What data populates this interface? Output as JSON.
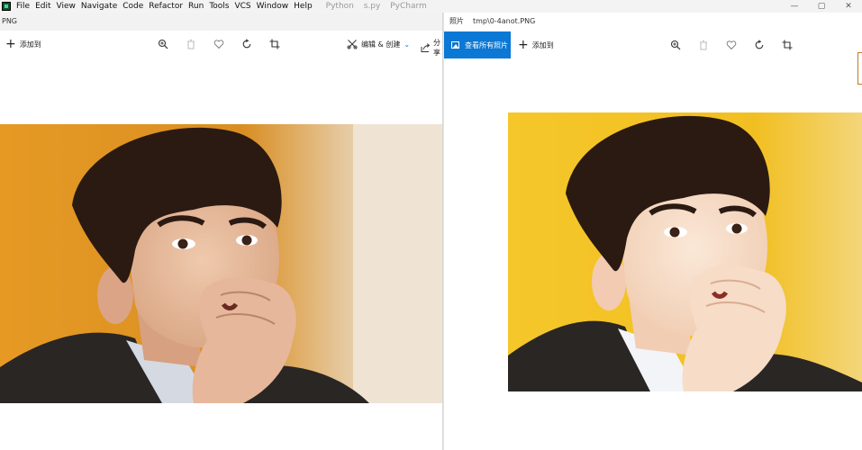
{
  "ide": {
    "menu": [
      "File",
      "Edit",
      "View",
      "Navigate",
      "Code",
      "Refactor",
      "Run",
      "Tools",
      "VCS",
      "Window",
      "Help"
    ],
    "title_parts": [
      "Python",
      "s.py",
      "PyCharm"
    ],
    "controls": [
      "—",
      "▢",
      "✕"
    ]
  },
  "left_window": {
    "title": "PNG",
    "add_label": "添加到",
    "edit_label": "编辑 & 创建",
    "share_label": "分享"
  },
  "right_window": {
    "app_name": "照片",
    "file_name": "tmp\\0-4anot.PNG",
    "view_all_label": "查看所有照片",
    "add_label": "添加到"
  },
  "icons": [
    "zoom-icon",
    "delete-icon",
    "heart-icon",
    "rotate-icon",
    "crop-icon",
    "edit-icon",
    "share-icon",
    "image-icon",
    "plus-icon"
  ],
  "colors": {
    "accent_blue": "#0a78d4",
    "ide_logo": "#0f5132"
  }
}
